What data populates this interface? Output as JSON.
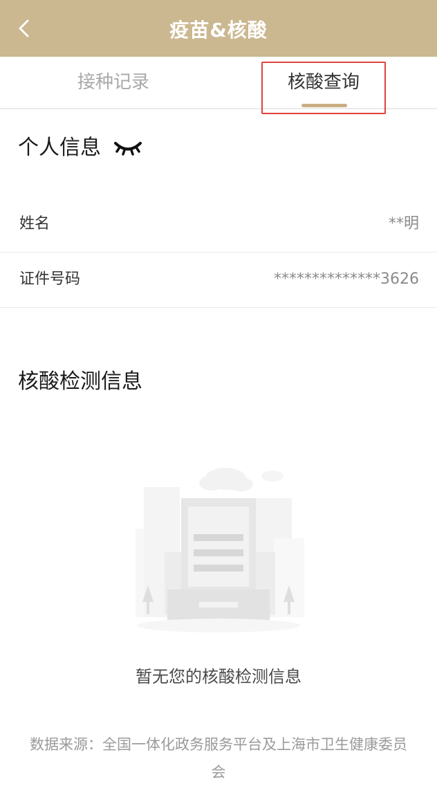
{
  "header": {
    "title": "疫苗&核酸",
    "back_icon": "chevron-left-icon",
    "background_color": "#cbb891"
  },
  "tabs": [
    {
      "label": "接种记录",
      "active": false
    },
    {
      "label": "核酸查询",
      "active": true
    }
  ],
  "accent_color": "#c9ae82",
  "highlight_color": "#e0413b",
  "personal": {
    "title": "个人信息",
    "toggle_icon": "eye-closed-icon",
    "rows": [
      {
        "label": "姓名",
        "value": "**明"
      },
      {
        "label": "证件号码",
        "value": "**************3626"
      }
    ]
  },
  "nat": {
    "title": "核酸检测信息",
    "empty_illustration_icon": "empty-document-icon",
    "empty_text": "暂无您的核酸检测信息"
  },
  "footer": {
    "line1": "数据来源：全国一体化政务服务平台及上海市卫生健康委员",
    "line2": "会"
  }
}
